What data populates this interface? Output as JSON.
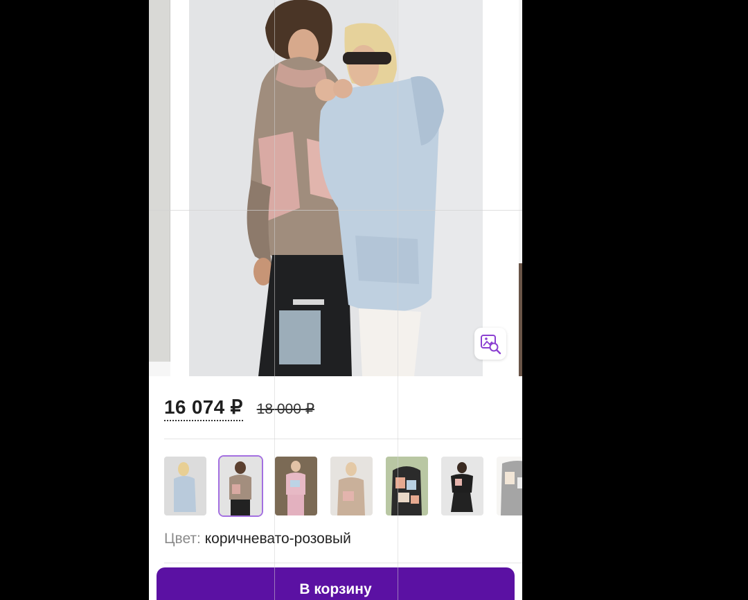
{
  "product": {
    "price_current": "16 074 ₽",
    "price_old": "18 000 ₽",
    "color_label": "Цвет:",
    "color_value": "коричневато-розовый",
    "cart_button": "В корзину"
  },
  "gallery": {
    "zoom_icon": "image-search-icon",
    "thumbnails": [
      {
        "name": "thumb-light-blue-hoodie",
        "selected": false
      },
      {
        "name": "thumb-brown-pink-hoodie",
        "selected": true
      },
      {
        "name": "thumb-pink-tracksuit",
        "selected": false
      },
      {
        "name": "thumb-beige-hoodie",
        "selected": false
      },
      {
        "name": "thumb-patchwork-hoodie",
        "selected": false
      },
      {
        "name": "thumb-black-tracksuit",
        "selected": false
      },
      {
        "name": "thumb-patchwork-partial",
        "selected": false
      }
    ]
  },
  "colors": {
    "accent": "#5b11a3",
    "selected_border": "#a36fe0"
  }
}
